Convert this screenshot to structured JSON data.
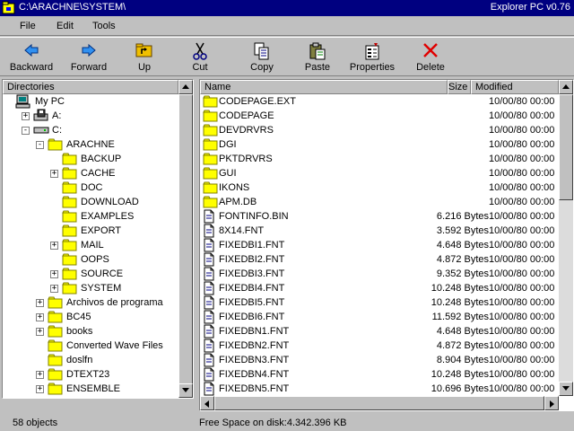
{
  "titlebar": {
    "path": "C:\\ARACHNE\\SYSTEM\\",
    "app_name": "Explorer PC v0.76"
  },
  "menu": {
    "file": "File",
    "edit": "Edit",
    "tools": "Tools"
  },
  "toolbar": {
    "backward": "Backward",
    "forward": "Forward",
    "up": "Up",
    "cut": "Cut",
    "copy": "Copy",
    "paste": "Paste",
    "properties": "Properties",
    "delete": "Delete"
  },
  "directories": {
    "header": "Directories",
    "items": [
      {
        "label": "My PC",
        "icon": "computer-icon",
        "level": 0,
        "expander": ""
      },
      {
        "label": "A:",
        "icon": "floppy-drive-icon",
        "level": 1,
        "expander": "+"
      },
      {
        "label": "C:",
        "icon": "hard-drive-icon",
        "level": 1,
        "expander": "-"
      },
      {
        "label": "ARACHNE",
        "icon": "folder-icon",
        "level": 2,
        "expander": "-"
      },
      {
        "label": "BACKUP",
        "icon": "folder-icon",
        "level": 3,
        "expander": ""
      },
      {
        "label": "CACHE",
        "icon": "folder-icon",
        "level": 3,
        "expander": "+"
      },
      {
        "label": "DOC",
        "icon": "folder-icon",
        "level": 3,
        "expander": ""
      },
      {
        "label": "DOWNLOAD",
        "icon": "folder-icon",
        "level": 3,
        "expander": ""
      },
      {
        "label": "EXAMPLES",
        "icon": "folder-icon",
        "level": 3,
        "expander": ""
      },
      {
        "label": "EXPORT",
        "icon": "folder-icon",
        "level": 3,
        "expander": ""
      },
      {
        "label": "MAIL",
        "icon": "folder-icon",
        "level": 3,
        "expander": "+"
      },
      {
        "label": "OOPS",
        "icon": "folder-icon",
        "level": 3,
        "expander": ""
      },
      {
        "label": "SOURCE",
        "icon": "folder-icon",
        "level": 3,
        "expander": "+"
      },
      {
        "label": "SYSTEM",
        "icon": "folder-icon",
        "level": 3,
        "expander": "+"
      },
      {
        "label": "Archivos de programa",
        "icon": "folder-icon",
        "level": 2,
        "expander": "+"
      },
      {
        "label": "BC45",
        "icon": "folder-icon",
        "level": 2,
        "expander": "+"
      },
      {
        "label": "books",
        "icon": "folder-icon",
        "level": 2,
        "expander": "+"
      },
      {
        "label": "Converted Wave Files",
        "icon": "folder-icon",
        "level": 2,
        "expander": ""
      },
      {
        "label": "doslfn",
        "icon": "folder-icon",
        "level": 2,
        "expander": ""
      },
      {
        "label": "DTEXT23",
        "icon": "folder-icon",
        "level": 2,
        "expander": "+"
      },
      {
        "label": "ENSEMBLE",
        "icon": "folder-icon",
        "level": 2,
        "expander": "+"
      }
    ]
  },
  "files": {
    "columns": {
      "name": "Name",
      "size": "Size",
      "modified": "Modified"
    },
    "rows": [
      {
        "name": "CODEPAGE.EXT",
        "size": "",
        "modified": "10/00/80 00:00",
        "type": "folder"
      },
      {
        "name": "CODEPAGE",
        "size": "",
        "modified": "10/00/80 00:00",
        "type": "folder"
      },
      {
        "name": "DEVDRVRS",
        "size": "",
        "modified": "10/00/80 00:00",
        "type": "folder"
      },
      {
        "name": "DGI",
        "size": "",
        "modified": "10/00/80 00:00",
        "type": "folder"
      },
      {
        "name": "PKTDRVRS",
        "size": "",
        "modified": "10/00/80 00:00",
        "type": "folder"
      },
      {
        "name": "GUI",
        "size": "",
        "modified": "10/00/80 00:00",
        "type": "folder"
      },
      {
        "name": "IKONS",
        "size": "",
        "modified": "10/00/80 00:00",
        "type": "folder"
      },
      {
        "name": "APM.DB",
        "size": "",
        "modified": "10/00/80 00:00",
        "type": "folder"
      },
      {
        "name": "FONTINFO.BIN",
        "size": "6.216 Bytes",
        "modified": "10/00/80 00:00",
        "type": "file"
      },
      {
        "name": "8X14.FNT",
        "size": "3.592 Bytes",
        "modified": "10/00/80 00:00",
        "type": "file"
      },
      {
        "name": "FIXEDBI1.FNT",
        "size": "4.648 Bytes",
        "modified": "10/00/80 00:00",
        "type": "file"
      },
      {
        "name": "FIXEDBI2.FNT",
        "size": "4.872 Bytes",
        "modified": "10/00/80 00:00",
        "type": "file"
      },
      {
        "name": "FIXEDBI3.FNT",
        "size": "9.352 Bytes",
        "modified": "10/00/80 00:00",
        "type": "file"
      },
      {
        "name": "FIXEDBI4.FNT",
        "size": "10.248 Bytes",
        "modified": "10/00/80 00:00",
        "type": "file"
      },
      {
        "name": "FIXEDBI5.FNT",
        "size": "10.248 Bytes",
        "modified": "10/00/80 00:00",
        "type": "file"
      },
      {
        "name": "FIXEDBI6.FNT",
        "size": "11.592 Bytes",
        "modified": "10/00/80 00:00",
        "type": "file"
      },
      {
        "name": "FIXEDBN1.FNT",
        "size": "4.648 Bytes",
        "modified": "10/00/80 00:00",
        "type": "file"
      },
      {
        "name": "FIXEDBN2.FNT",
        "size": "4.872 Bytes",
        "modified": "10/00/80 00:00",
        "type": "file"
      },
      {
        "name": "FIXEDBN3.FNT",
        "size": "8.904 Bytes",
        "modified": "10/00/80 00:00",
        "type": "file"
      },
      {
        "name": "FIXEDBN4.FNT",
        "size": "10.248 Bytes",
        "modified": "10/00/80 00:00",
        "type": "file"
      },
      {
        "name": "FIXEDBN5.FNT",
        "size": "10.696 Bytes",
        "modified": "10/00/80 00:00",
        "type": "file"
      }
    ]
  },
  "status": {
    "objects": "58 objects",
    "free_space": "Free Space on disk:4.342.396 KB"
  },
  "colors": {
    "titlebar": "#000080",
    "folder": "#ffff00",
    "face": "#c0c0c0"
  }
}
